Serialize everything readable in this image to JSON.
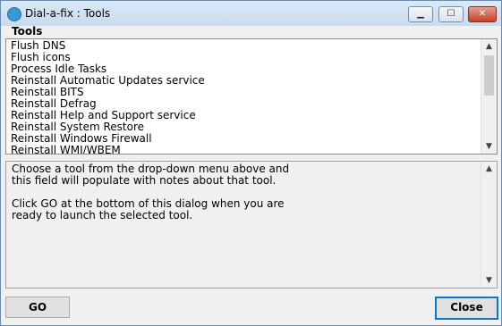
{
  "window": {
    "title": "Dial-a-fix : Tools",
    "minimize_glyph": "▁",
    "maximize_glyph": "☐",
    "close_glyph": "✕"
  },
  "tools": {
    "label": "Tools",
    "items": [
      "Flush DNS",
      "Flush icons",
      "Process Idle Tasks",
      "Reinstall Automatic Updates service",
      "Reinstall BITS",
      "Reinstall Defrag",
      "Reinstall Help and Support service",
      "Reinstall System Restore",
      "Reinstall Windows Firewall",
      "Reinstall WMI/WBEM"
    ]
  },
  "notes": {
    "lines": [
      "Choose a tool from the drop-down menu above and",
      "this field will populate with notes about that tool.",
      "",
      "Click GO at the bottom of this dialog when you are",
      "ready to launch the selected tool."
    ]
  },
  "buttons": {
    "go_label": "GO",
    "close_label": "Close"
  },
  "icons": {
    "app": "app-icon",
    "scroll_up": "scroll-up-icon",
    "scroll_down": "scroll-down-icon"
  }
}
